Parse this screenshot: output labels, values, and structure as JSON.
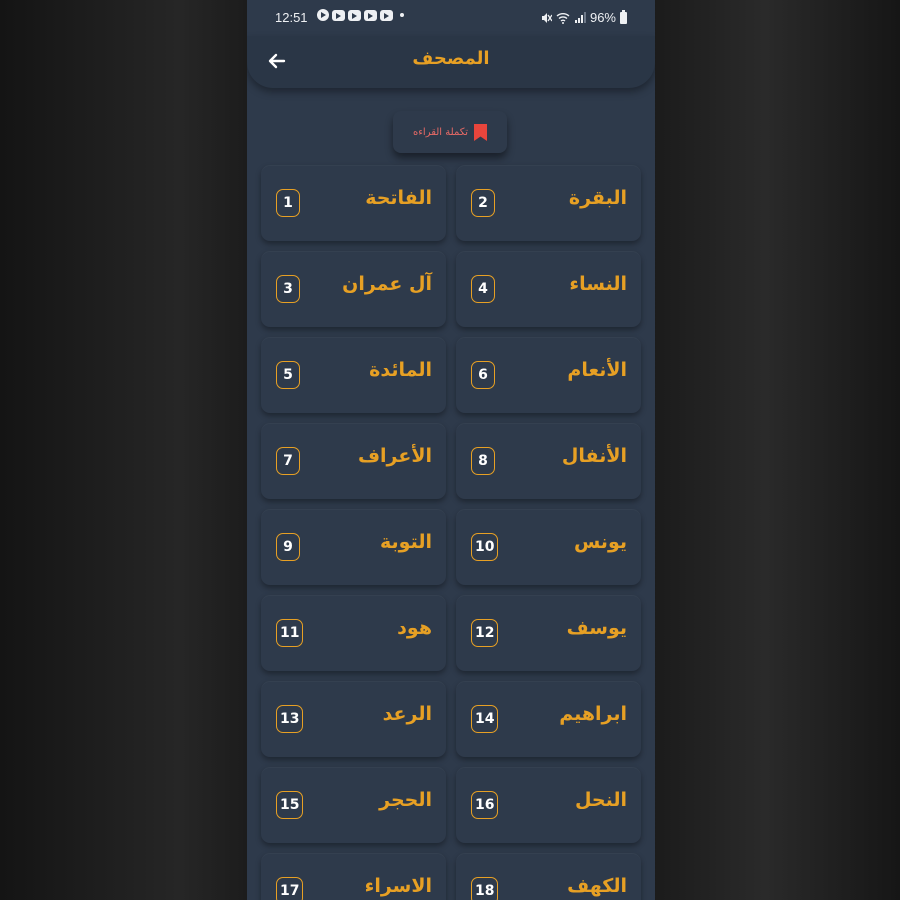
{
  "status_bar": {
    "time": "12:51",
    "battery": "96%"
  },
  "app_bar": {
    "title": "المصحف",
    "back_icon": "arrow-left-icon"
  },
  "resume_reading": {
    "label": "تكملة القراءه",
    "icon": "bookmark-icon",
    "icon_color": "#e8453c"
  },
  "colors": {
    "accent": "#e7a024",
    "background": "#2e3a4b",
    "text": "#ffffff"
  },
  "surahs": [
    {
      "number": "1",
      "name": "الفاتحة"
    },
    {
      "number": "2",
      "name": "البقرة"
    },
    {
      "number": "3",
      "name": "آل عمران"
    },
    {
      "number": "4",
      "name": "النساء"
    },
    {
      "number": "5",
      "name": "المائدة"
    },
    {
      "number": "6",
      "name": "الأنعام"
    },
    {
      "number": "7",
      "name": "الأعراف"
    },
    {
      "number": "8",
      "name": "الأنفال"
    },
    {
      "number": "9",
      "name": "التوبة"
    },
    {
      "number": "10",
      "name": "يونس"
    },
    {
      "number": "11",
      "name": "هود"
    },
    {
      "number": "12",
      "name": "يوسف"
    },
    {
      "number": "13",
      "name": "الرعد"
    },
    {
      "number": "14",
      "name": "ابراهيم"
    },
    {
      "number": "15",
      "name": "الحجر"
    },
    {
      "number": "16",
      "name": "النحل"
    },
    {
      "number": "17",
      "name": "الاسراء"
    },
    {
      "number": "18",
      "name": "الكهف"
    }
  ]
}
